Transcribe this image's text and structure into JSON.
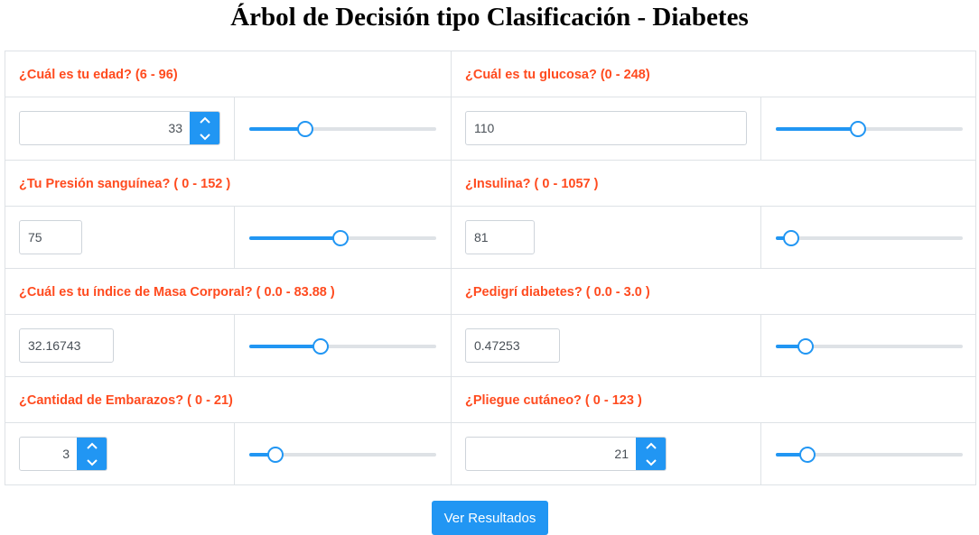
{
  "page": {
    "title": "Árbol de Decisión tipo Clasificación - Diabetes"
  },
  "fields": {
    "edad": {
      "label": "¿Cuál es tu edad? (6 - 96)",
      "value": "33",
      "min": 6,
      "max": 96,
      "slider_fraction": 0.3
    },
    "glucosa": {
      "label": "¿Cuál es tu glucosa? (0 - 248)",
      "value": "110",
      "min": 0,
      "max": 248,
      "slider_fraction": 0.44
    },
    "presion": {
      "label": "¿Tu Presión sanguínea? ( 0 - 152 )",
      "value": "75",
      "min": 0,
      "max": 152,
      "slider_fraction": 0.49
    },
    "insulina": {
      "label": "¿Insulina? ( 0 - 1057 )",
      "value": "81",
      "min": 0,
      "max": 1057,
      "slider_fraction": 0.08
    },
    "imc": {
      "label": "¿Cuál es tu índice de Masa Corporal? ( 0.0 - 83.88 )",
      "value": "32.16743",
      "min": 0.0,
      "max": 83.88,
      "slider_fraction": 0.38
    },
    "pedigri": {
      "label": "¿Pedigrí diabetes? ( 0.0 - 3.0 )",
      "value": "0.47253",
      "min": 0.0,
      "max": 3.0,
      "slider_fraction": 0.16
    },
    "embarazos": {
      "label": "¿Cantidad de Embarazos? ( 0 - 21)",
      "value": "3",
      "min": 0,
      "max": 21,
      "slider_fraction": 0.14
    },
    "pliegue": {
      "label": "¿Pliegue cutáneo? ( 0 - 123 )",
      "value": "21",
      "min": 0,
      "max": 123,
      "slider_fraction": 0.17
    }
  },
  "submit": {
    "label": "Ver Resultados"
  },
  "colors": {
    "label": "#ff4b1f",
    "accent": "#2196f3",
    "track": "#dee2e6",
    "border": "#dee2e6"
  },
  "icons": {
    "spin_up": "chevron-up-icon",
    "spin_down": "chevron-down-icon"
  }
}
